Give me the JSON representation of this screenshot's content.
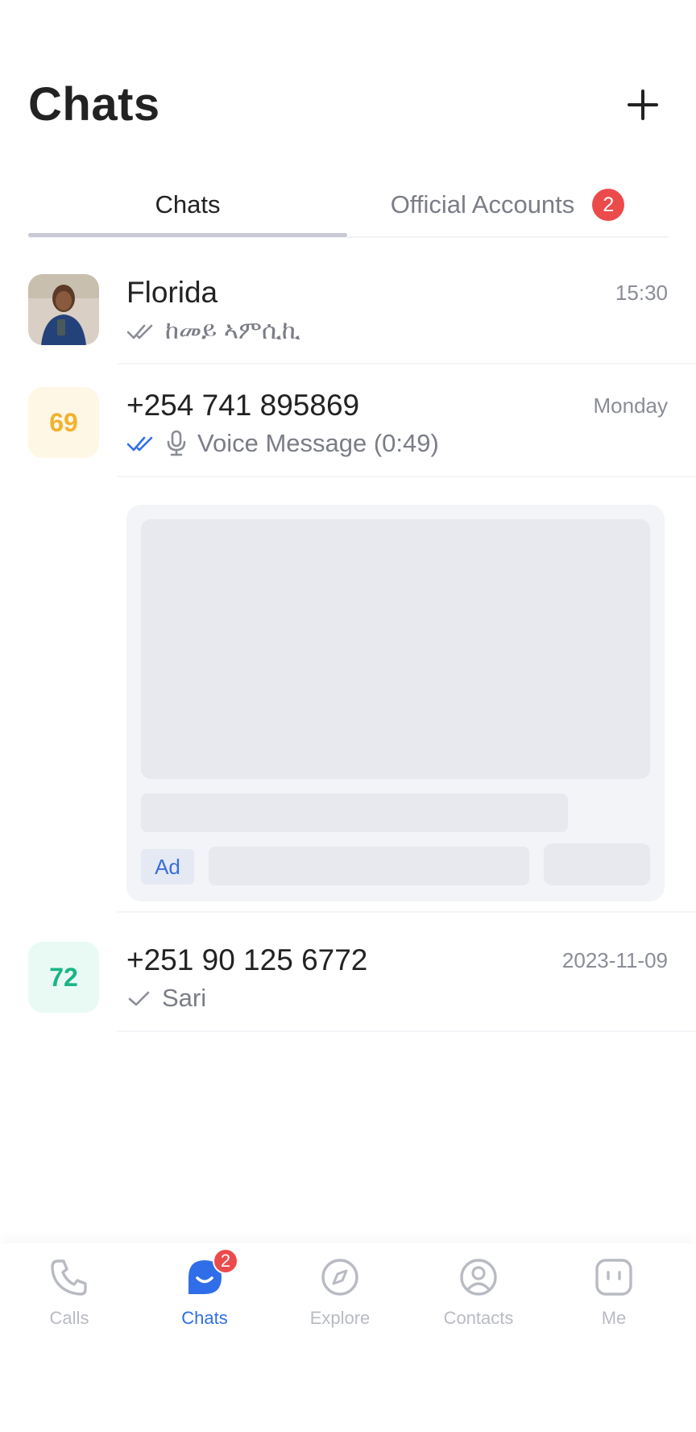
{
  "header": {
    "title": "Chats"
  },
  "tabs": [
    {
      "label": "Chats",
      "active": true
    },
    {
      "label": "Official Accounts",
      "badge": "2"
    }
  ],
  "chats": [
    {
      "name": "Florida",
      "time": "15:30",
      "preview": "ከመይ ኣምሲኪ",
      "status": "read",
      "avatar_type": "photo"
    },
    {
      "name": "+254 741 895869",
      "time": "Monday",
      "preview": "Voice Message (0:49)",
      "status": "read-blue",
      "avatar_text": "69",
      "avatar_color": "#f2b22e"
    },
    {
      "name": "+251 90 125 6772",
      "time": "2023-11-09",
      "preview": "Sari",
      "status": "sent",
      "avatar_text": "72",
      "avatar_color": "#19b586"
    }
  ],
  "ad": {
    "tag": "Ad"
  },
  "bottom_nav": [
    {
      "label": "Calls",
      "icon": "phone-icon"
    },
    {
      "label": "Chats",
      "icon": "chat-bubble-icon",
      "active": true,
      "badge": "2"
    },
    {
      "label": "Explore",
      "icon": "compass-icon"
    },
    {
      "label": "Contacts",
      "icon": "person-circle-icon"
    },
    {
      "label": "Me",
      "icon": "face-icon"
    }
  ],
  "colors": {
    "accent": "#2f6ee8",
    "badge": "#eb4b4b"
  }
}
